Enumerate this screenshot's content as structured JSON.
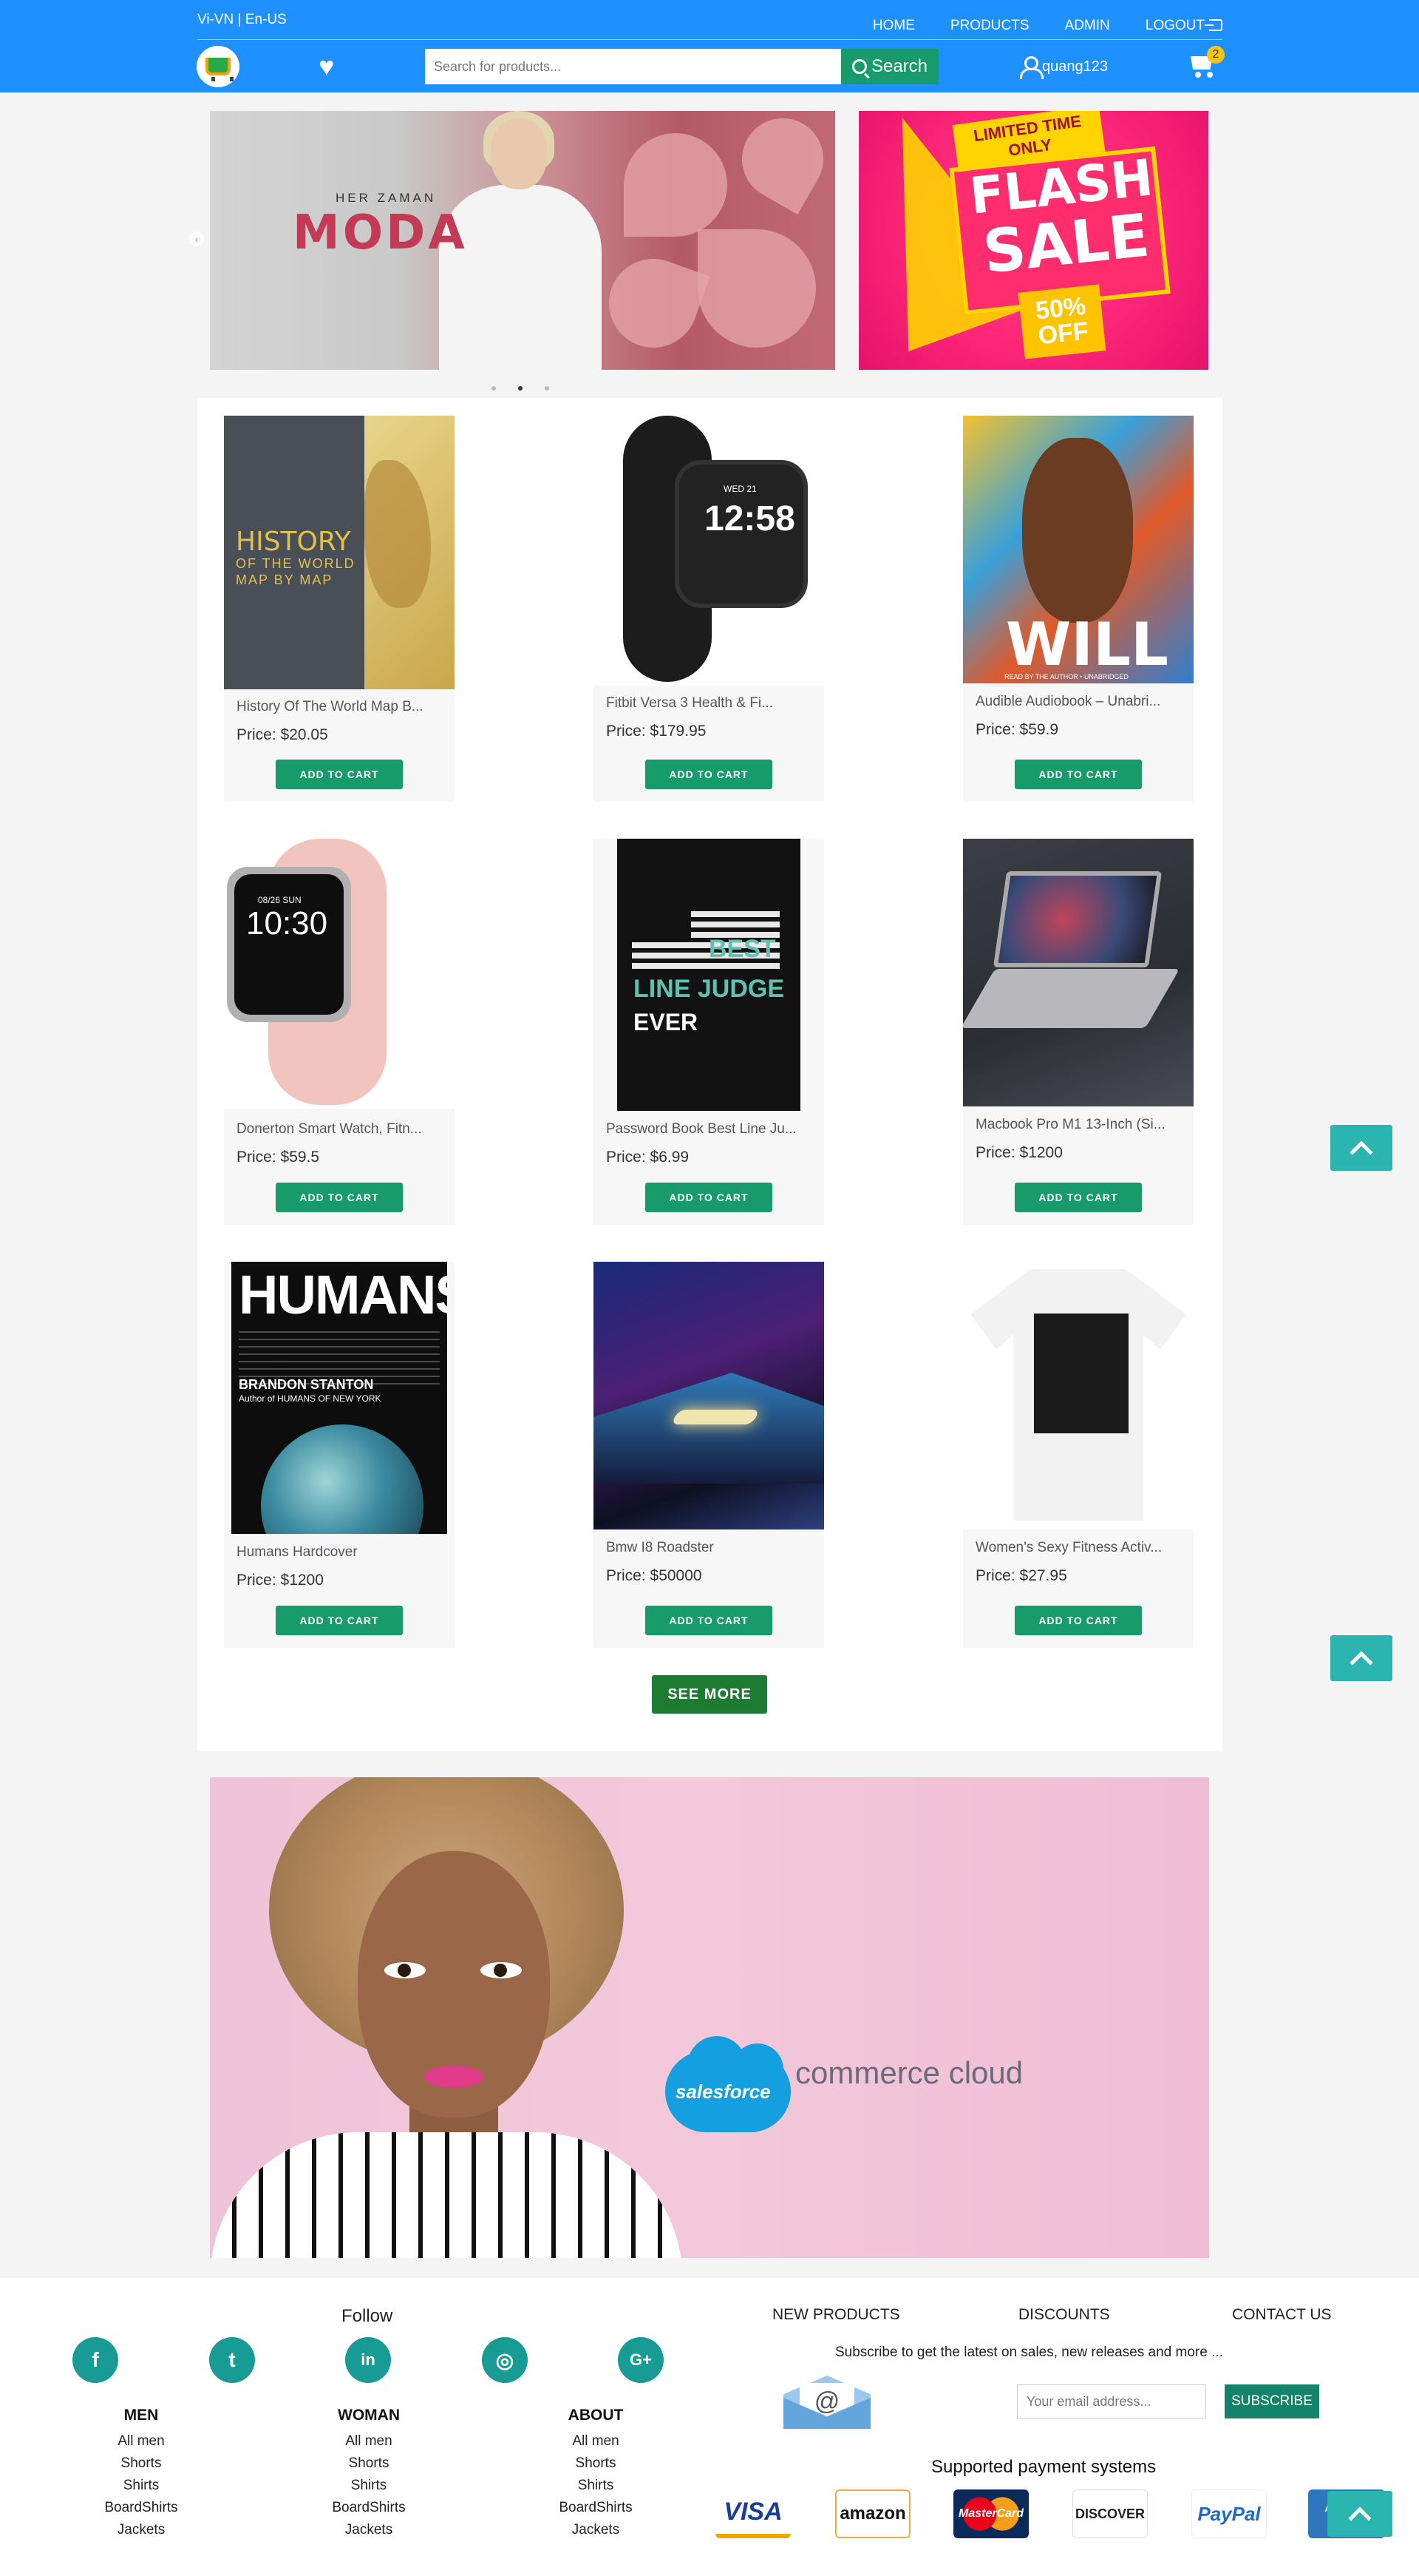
{
  "header": {
    "lang": "Vi-VN | En-US",
    "nav": [
      "HOME",
      "PRODUCTS",
      "ADMIN",
      "LOGOUT"
    ],
    "search_placeholder": "Search for products...",
    "search_label": "Search",
    "username": "quang123",
    "cart_count": "2",
    "icons": {
      "logo": "shopping-cart-logo",
      "wishlist": "heart-icon",
      "search": "search-icon",
      "user": "user-icon",
      "cart": "cart-icon",
      "logout": "logout-icon"
    },
    "colors": {
      "bar": "#1e90ff",
      "search_button": "#179b6a",
      "badge": "#f5c518"
    }
  },
  "slider": {
    "main": {
      "eyebrow": "HER ZAMAN",
      "title": "MODA"
    },
    "side": {
      "tag": "LIMITED TIME ONLY",
      "line1": "FLASH",
      "line2": "SALE",
      "off_pct": "50%",
      "off_word": "OFF"
    },
    "dots": 3,
    "active_dot": 1
  },
  "products": {
    "add_label": "ADD TO CART",
    "items": [
      {
        "name": "History Of The World Map B...",
        "price": "Price: $20.05"
      },
      {
        "name": "Fitbit Versa 3 Health & Fi...",
        "price": "Price: $179.95"
      },
      {
        "name": "Audible Audiobook – Unabri...",
        "price": "Price: $59.9"
      },
      {
        "name": "Donerton Smart Watch, Fitn...",
        "price": "Price: $59.5"
      },
      {
        "name": "Password Book Best Line Ju...",
        "price": "Price: $6.99"
      },
      {
        "name": "Macbook Pro M1 13-Inch (Si...",
        "price": "Price: $1200"
      },
      {
        "name": "Humans Hardcover",
        "price": "Price: $1200"
      },
      {
        "name": "Bmw I8 Roadster",
        "price": "Price: $50000"
      },
      {
        "name": "Women's Sexy Fitness Activ...",
        "price": "Price: $27.95"
      }
    ],
    "images": {
      "history_title": "HISTORY",
      "history_sub1": "OF THE WORLD",
      "history_sub2": "MAP BY MAP",
      "watch_time": "12:58",
      "watch_date": "WED 21",
      "will": "WILL",
      "will_sub": "READ BY THE AUTHOR • UNABRIDGED",
      "donerton_time": "10:30",
      "donerton_date": "08/26 SUN",
      "judge_1": "BEST",
      "judge_2": "LINE JUDGE",
      "judge_3": "EVER",
      "humans_title": "HUMANS",
      "humans_author": "BRANDON STANTON",
      "humans_sub": "Author of HUMANS OF NEW YORK"
    },
    "see_more": "SEE MORE"
  },
  "promo": {
    "brand": "salesforce",
    "product": "commerce cloud"
  },
  "footer": {
    "follow": "Follow",
    "social": [
      "facebook-icon",
      "twitter-icon",
      "linkedin-icon",
      "instagram-icon",
      "google-plus-icon"
    ],
    "columns": [
      {
        "title": "MEN",
        "links": [
          "All men",
          "Shorts",
          "Shirts",
          "BoardShirts",
          "Jackets"
        ]
      },
      {
        "title": "WOMAN",
        "links": [
          "All men",
          "Shorts",
          "Shirts",
          "BoardShirts",
          "Jackets"
        ]
      },
      {
        "title": "ABOUT",
        "links": [
          "All men",
          "Shorts",
          "Shirts",
          "BoardShirts",
          "Jackets"
        ]
      }
    ],
    "nav": [
      "NEW PRODUCTS",
      "DISCOUNTS",
      "CONTACT US"
    ],
    "subscribe_text": "Subscribe to get the latest on sales, new releases and more ...",
    "email_placeholder": "Your email address...",
    "subscribe_label": "SUBSCRIBE",
    "payments_title": "Supported payment systems",
    "payments": [
      "VISA",
      "amazon",
      "MasterCard",
      "DISCOVER",
      "PayPal",
      "AMERICAN EXPRESS"
    ]
  }
}
